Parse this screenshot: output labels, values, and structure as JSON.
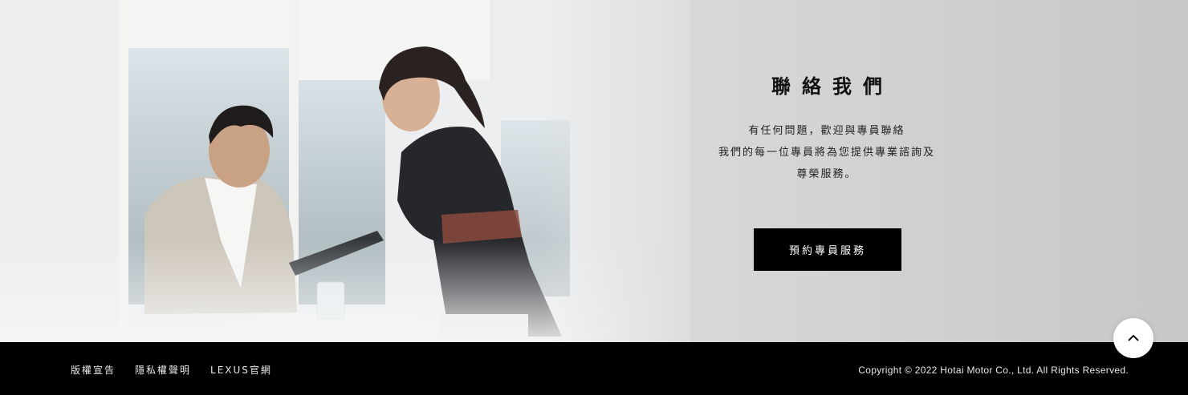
{
  "contact": {
    "title": "聯絡我們",
    "desc_lines": [
      "有任何問題，歡迎與專員聯絡",
      "我們的每一位專員將為您提供專業諮詢及",
      "尊榮服務。"
    ],
    "cta_label": "預約專員服務"
  },
  "back_to_top": {
    "icon": "chevron-up-icon"
  },
  "footer": {
    "links": [
      "版權宣告",
      "隱私權聲明",
      "LEXUS官網"
    ],
    "copyright": "Copyright © 2022 Hotai Motor Co., Ltd. All Rights Reserved."
  }
}
